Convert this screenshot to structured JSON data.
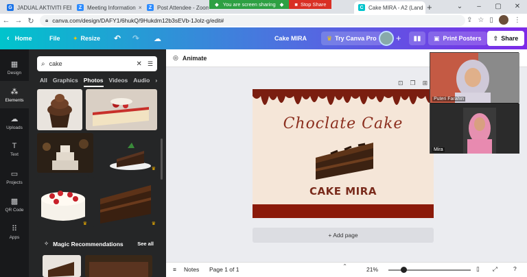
{
  "browser": {
    "tabs": [
      {
        "title": "JADUAL AKTIVITI FEB",
        "color": "#1a73e8"
      },
      {
        "title": "Meeting Information",
        "color": "#2d8cff"
      },
      {
        "title": "Post Attendee - Zoom",
        "color": "#2d8cff"
      },
      {
        "title": "Cake MIRA - A2 (Land",
        "color": "#00c4cc"
      }
    ],
    "sharing_message": "You are screen sharing",
    "stop_share_label": "Stop Share",
    "url": "canva.com/design/DAFY1/6hukQ/9Hukdm12b3sEVb-1Jolz-g/edit#"
  },
  "header": {
    "home_label": "Home",
    "file_label": "File",
    "resize_label": "Resize",
    "project_title": "Cake MIRA",
    "try_pro_label": "Try Canva Pro",
    "print_label": "Print Posters",
    "share_label": "Share"
  },
  "rail": [
    {
      "label": "Design",
      "icon": "▦"
    },
    {
      "label": "Elements",
      "icon": "⁂"
    },
    {
      "label": "Uploads",
      "icon": "☁"
    },
    {
      "label": "Text",
      "icon": "T"
    },
    {
      "label": "Projects",
      "icon": "▭"
    },
    {
      "label": "QR Code",
      "icon": "▩"
    },
    {
      "label": "Apps",
      "icon": "⠿"
    }
  ],
  "panel": {
    "search_value": "cake",
    "tabs": [
      "All",
      "Graphics",
      "Photos",
      "Videos",
      "Audio"
    ],
    "active_tab": "Photos",
    "magic_label": "Magic Recommendations",
    "see_all_label": "See all"
  },
  "workspace": {
    "animate_label": "Animate",
    "design_title": "Choclate Cake",
    "design_subtitle": "CAKE MIRA",
    "add_page_label": "+ Add page"
  },
  "bottombar": {
    "notes_label": "Notes",
    "page_label": "Page 1 of 1",
    "zoom_label": "21%",
    "zoom_percent": 21
  },
  "video": [
    {
      "name": "Puteri Farahin"
    },
    {
      "name": "Mira"
    }
  ],
  "colors": {
    "canva_teal": "#00c4cc",
    "canva_purple": "#7d2ae8",
    "chocolate": "#8b2e1e",
    "design_bg": "#f5e6d8"
  }
}
